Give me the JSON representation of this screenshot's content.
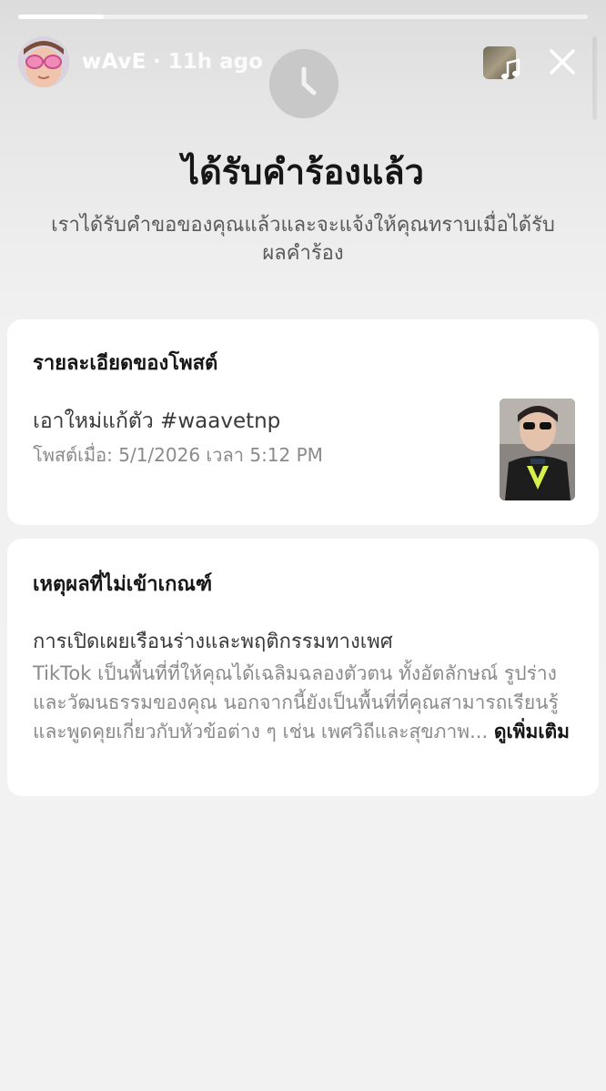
{
  "story": {
    "progress": 0.15
  },
  "header": {
    "username": "wAvE",
    "time_ago": "· 11h ago",
    "avatar_icon": "avatar-sunglasses",
    "music_icon": "music-note-icon",
    "close_icon": "close-icon"
  },
  "status": {
    "icon": "clock-icon",
    "title": "ได้รับคำร้องแล้ว",
    "subtitle": "เราได้รับคำขอของคุณแล้วและจะแจ้งให้คุณทราบเมื่อได้รับผลคำร้อง"
  },
  "post_details": {
    "heading": "รายละเอียดของโพสต์",
    "caption": "เอาใหม่แก้ตัว #waavetnp",
    "posted_at": "โพสต์เมื่อ: 5/1/2026 เวลา 5:12 PM"
  },
  "violation": {
    "heading": "เหตุผลที่ไม่เข้าเกณฑ์",
    "reason_title": "การเปิดเผยเรือนร่างและพฤติกรรมทางเพศ",
    "reason_description": "TikTok เป็นพื้นที่ที่ให้คุณได้เฉลิมฉลองตัวตน ทั้งอัตลักษณ์ รูปร่าง และวัฒนธรรมของคุณ นอกจากนี้ยังเป็นพื้นที่ที่คุณสามารถเรียนรู้และพูดคุยเกี่ยวกับหัวข้อต่าง ๆ เช่น เพศวิถีและสุขภาพ...",
    "see_more": "ดูเพิ่มเติม"
  },
  "colors": {
    "background": "#f2f2f2",
    "card": "#ffffff",
    "heading_text": "#161616",
    "secondary_text": "#8a8a8a",
    "clock_circle": "#c8c8c8"
  }
}
